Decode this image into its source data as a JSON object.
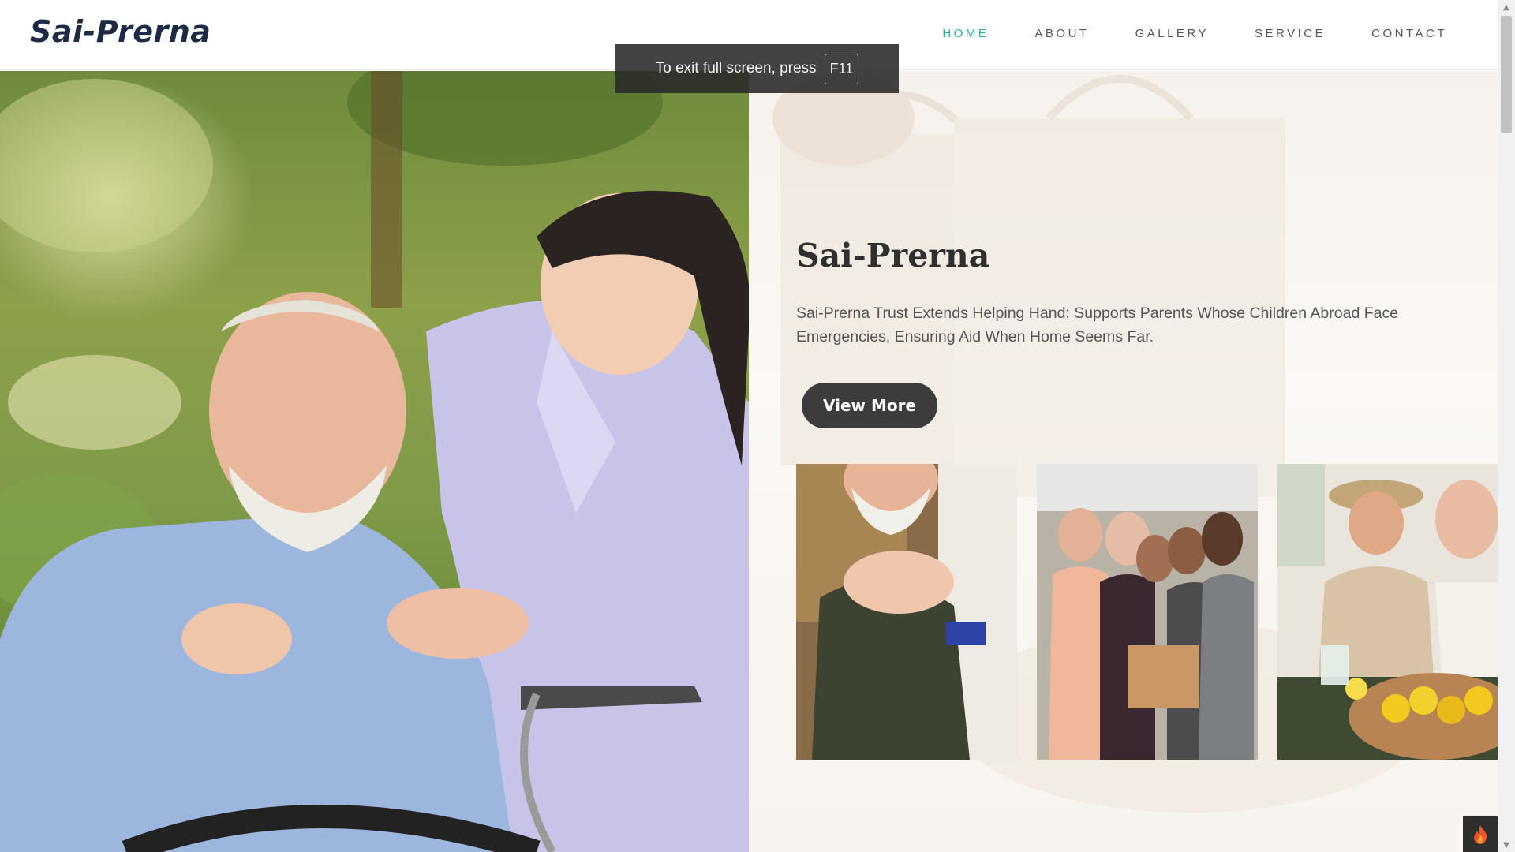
{
  "header": {
    "logo": "Sai-Prerna",
    "nav": [
      {
        "label": "HOME",
        "active": true
      },
      {
        "label": "ABOUT",
        "active": false
      },
      {
        "label": "GALLERY",
        "active": false
      },
      {
        "label": "SERVICE",
        "active": false
      },
      {
        "label": "CONTACT",
        "active": false
      }
    ]
  },
  "fullscreen_notice": {
    "text": "To exit full screen, press",
    "key": "F11"
  },
  "hero": {
    "title": "Sai-Prerna",
    "description": "Sai-Prerna Trust Extends Helping Hand: Supports Parents Whose Children Abroad Face Emergencies, Ensuring Aid When Home Seems Far.",
    "button_label": "View More"
  },
  "thumbnails": [
    {
      "icon": "elderly-care-photo"
    },
    {
      "icon": "volunteers-group-photo"
    },
    {
      "icon": "cooking-together-photo"
    }
  ],
  "colors": {
    "nav_active": "#2bb5a0",
    "button_bg": "#3c3c3c",
    "logo": "#1d2a44"
  },
  "floating_button": {
    "icon": "fire-icon"
  }
}
